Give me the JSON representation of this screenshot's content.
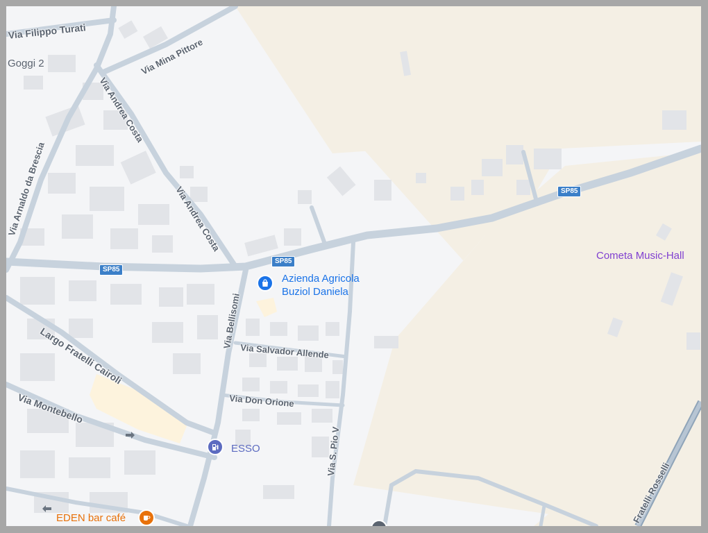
{
  "map": {
    "colors": {
      "background": "#f4f5f7",
      "road": "#c7d2dd",
      "building": "#e2e4e8",
      "park_area": "#f4efe4",
      "highlight_area": "#fdf3dd",
      "major_road": "#8fa4b8"
    },
    "roads": {
      "filippo_turati": "Via Filippo Turati",
      "mina_pittore": "Via Mina Pittore",
      "andrea_costa_1": "Via Andrea Costa",
      "andrea_costa_2": "Via Andrea Costa",
      "arnaldo_da_brescia": "Via Arnaldo da Brescia",
      "bellisomi": "Via Bellisomi",
      "salvador_allende": "Via Salvador Allende",
      "don_orione": "Via Don Orione",
      "largo_cairoli": "Largo Fratelli Cairoli",
      "montebello": "Via Montebello",
      "pio_v": "Via S. Pio V",
      "fratelli_rosselli": "Fratelli Rosselli"
    },
    "route_shields": [
      "SP85",
      "SP85",
      "SP85"
    ],
    "places": {
      "goggi": "Goggi 2",
      "azienda": "Azienda Agricola\nBuziol Daniela",
      "cometa": "Cometa Music-Hall",
      "esso": "ESSO",
      "eden": "EDEN bar café"
    },
    "icons": {
      "azienda": "shopping-bag-icon",
      "esso": "gas-station-icon",
      "eden": "coffee-cup-icon"
    }
  }
}
